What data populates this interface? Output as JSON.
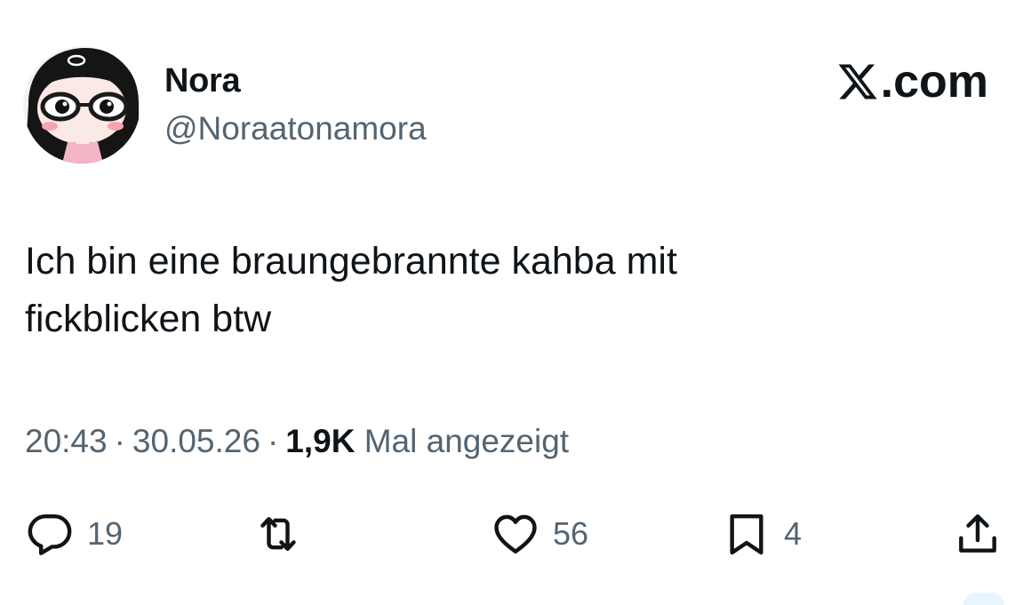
{
  "author": {
    "display_name": "Nora",
    "handle": "@Noraatonamora",
    "avatar_icon": "cartoon-girl-with-glasses-avatar"
  },
  "brand": {
    "logo_icon": "x-logo-icon",
    "label": ".com"
  },
  "tweet": {
    "line1": "Ich bin eine braungebrannte kahba mit",
    "line2": "fickblicken btw"
  },
  "meta": {
    "time": "20:43",
    "separator": "·",
    "date": "30.05.26",
    "views_count": "1,9K",
    "views_label": "Mal angezeigt"
  },
  "actions": {
    "reply": {
      "icon": "reply-bubble-icon",
      "count": "19"
    },
    "repost": {
      "icon": "repost-arrows-icon",
      "count": ""
    },
    "like": {
      "icon": "heart-icon",
      "count": "56"
    },
    "bookmark": {
      "icon": "bookmark-icon",
      "count": "4"
    },
    "share": {
      "icon": "share-icon"
    }
  },
  "colors": {
    "text_primary": "#0f1419",
    "text_secondary": "#536471",
    "background": "#ffffff"
  }
}
